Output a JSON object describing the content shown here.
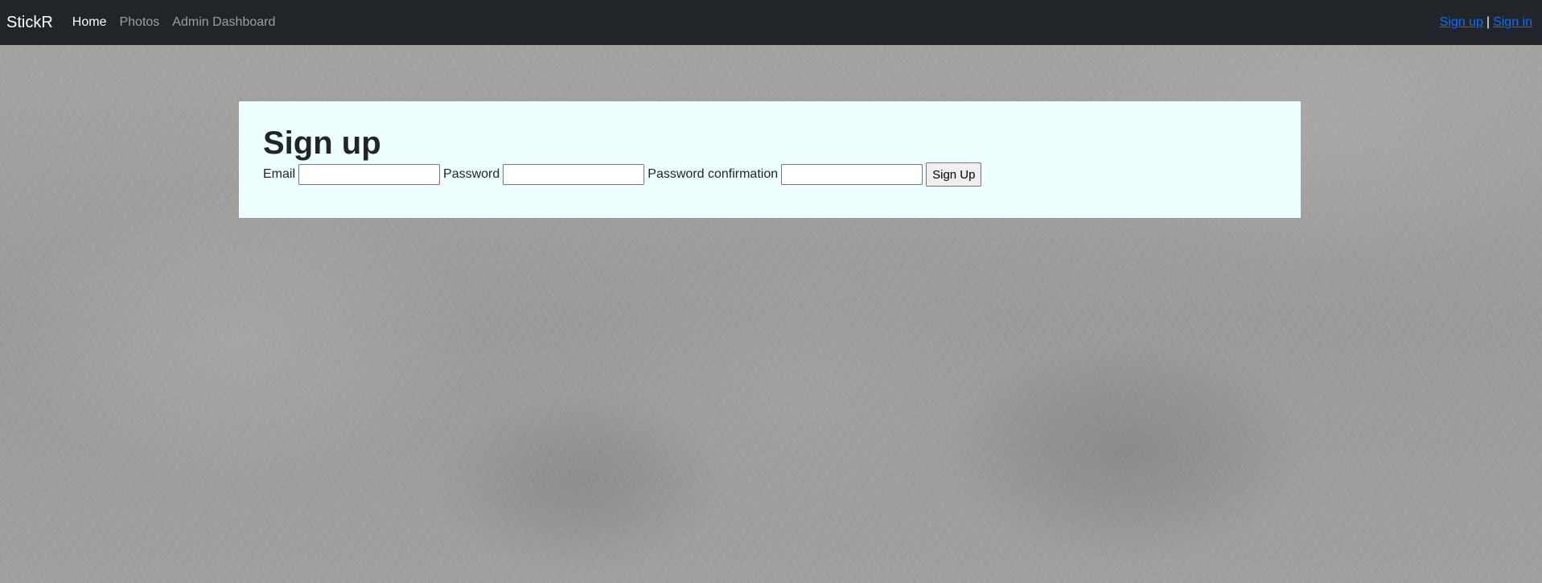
{
  "nav": {
    "brand": "StickR",
    "links": [
      {
        "label": "Home",
        "active": true
      },
      {
        "label": "Photos",
        "active": false
      },
      {
        "label": "Admin Dashboard",
        "active": false
      }
    ],
    "auth": {
      "signup": "Sign up",
      "separator": "|",
      "signin": "Sign in"
    }
  },
  "form": {
    "heading": "Sign up",
    "email_label": "Email",
    "email_value": "",
    "password_label": "Password",
    "password_value": "",
    "password_confirmation_label": "Password confirmation",
    "password_confirmation_value": "",
    "submit_label": "Sign Up"
  },
  "colors": {
    "navbar_bg": "#212529",
    "card_bg": "#eeffff",
    "link": "#0d6efd"
  }
}
